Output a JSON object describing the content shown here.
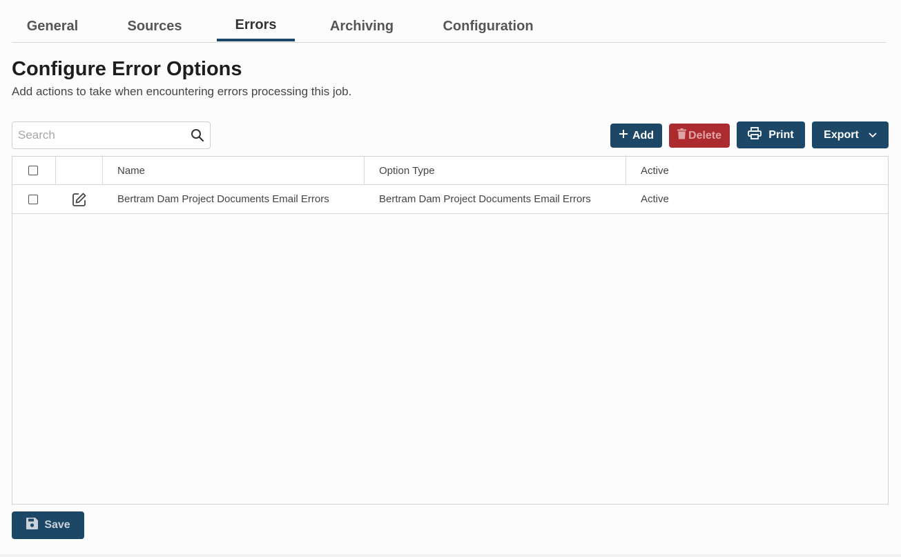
{
  "tabs": [
    {
      "label": "General"
    },
    {
      "label": "Sources"
    },
    {
      "label": "Errors"
    },
    {
      "label": "Archiving"
    },
    {
      "label": "Configuration"
    }
  ],
  "active_tab": "Errors",
  "page": {
    "title": "Configure Error Options",
    "subtitle": "Add actions to take when encountering errors processing this job."
  },
  "search": {
    "placeholder": "Search",
    "value": ""
  },
  "toolbar": {
    "add_label": "Add",
    "delete_label": "Delete",
    "print_label": "Print",
    "export_label": "Export"
  },
  "table": {
    "columns": [
      "Name",
      "Option Type",
      "Active"
    ],
    "rows": [
      {
        "name": "Bertram Dam Project Documents Email Errors",
        "option_type": "Bertram Dam Project Documents Email Errors",
        "active": "Active"
      }
    ]
  },
  "footer": {
    "save_label": "Save"
  },
  "colors": {
    "primary": "#1c4766",
    "danger": "#ab2b2f"
  }
}
